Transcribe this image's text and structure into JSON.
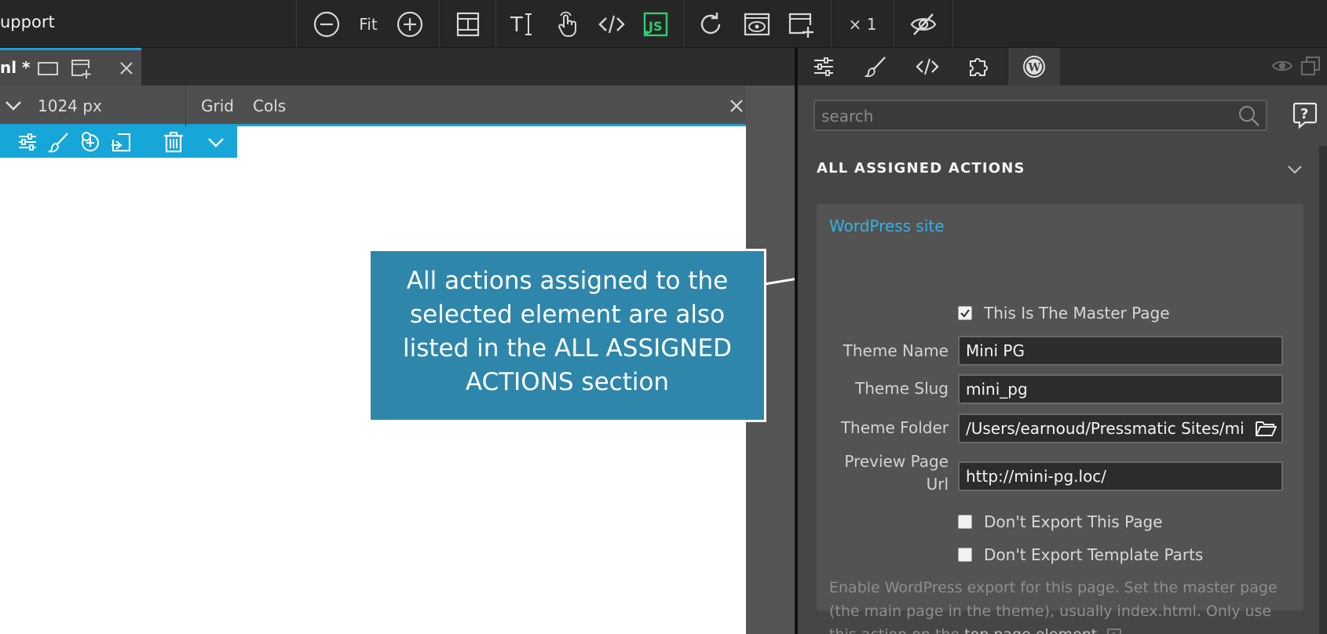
{
  "app": {
    "title": "upport"
  },
  "toolbar": {
    "zoom_out_icon": "zoom-out-icon",
    "fit_label": "Fit",
    "zoom_in_icon": "zoom-in-icon",
    "multiplier_label": "× 1"
  },
  "document_tab": {
    "name": "nl *"
  },
  "viewbar": {
    "width_label": "1024 px",
    "grid_label": "Grid",
    "cols_label": "Cols"
  },
  "callout": {
    "text": "All actions assigned to the selected element are also listed in the ALL ASSIGNED ACTIONS section"
  },
  "panel": {
    "search_placeholder": "search",
    "section_title": "ALL ASSIGNED ACTIONS",
    "action": {
      "title": "WordPress site",
      "master_page_label": "This Is The Master Page",
      "master_page_checked": true,
      "theme_name_label": "Theme Name",
      "theme_name_value": "Mini PG",
      "theme_slug_label": "Theme Slug",
      "theme_slug_value": "mini_pg",
      "theme_folder_label": "Theme Folder",
      "theme_folder_value": "/Users/earnoud/Pressmatic Sites/mi",
      "preview_url_label_line1": "Preview Page",
      "preview_url_label_line2": "Url",
      "preview_url_value": "http://mini-pg.loc/",
      "dont_export_page_label": "Don't Export This Page",
      "dont_export_parts_label": "Don't Export Template Parts",
      "help_text": "Enable WordPress export for this page. Set the master page (the main page in the theme), usually index.html. Only use this action on the",
      "help_text_strong": "top page element."
    }
  },
  "colors": {
    "accent": "#1aa0d8",
    "link": "#35b1e6",
    "callout_bg": "#2e86ab",
    "js_green": "#2ecc71"
  }
}
